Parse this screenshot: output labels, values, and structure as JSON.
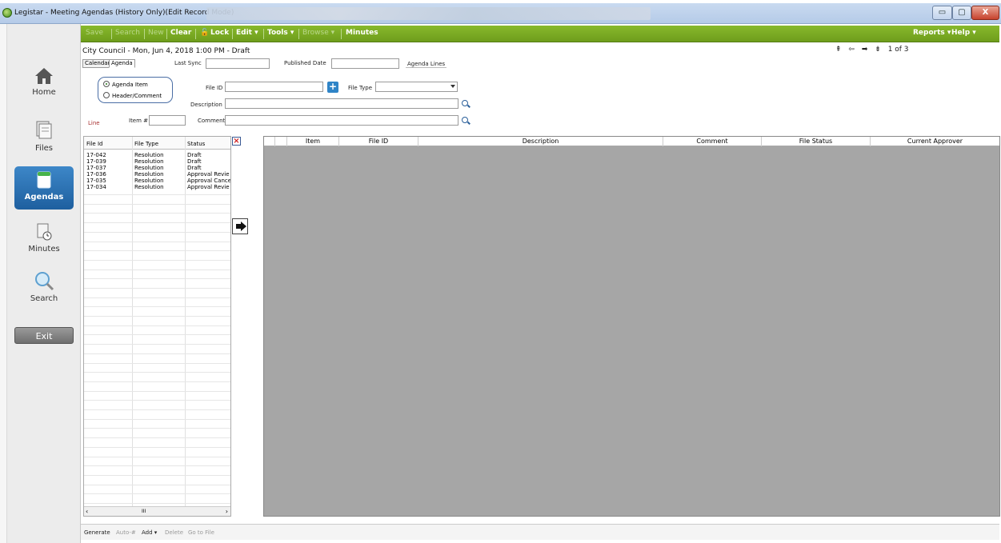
{
  "window": {
    "title": "Legistar - Meeting Agendas (History Only)(Edit Record Mode)",
    "min_glyph": "▭",
    "max_glyph": "▢",
    "close_glyph": "X"
  },
  "nav": {
    "items": [
      {
        "label": "Home",
        "icon": "home-icon"
      },
      {
        "label": "Files",
        "icon": "files-icon"
      },
      {
        "label": "Agendas",
        "icon": "agenda-icon"
      },
      {
        "label": "Minutes",
        "icon": "minutes-icon"
      },
      {
        "label": "Search",
        "icon": "search-icon"
      }
    ],
    "exit_label": "Exit"
  },
  "toolbar": {
    "save": "Save",
    "search": "Search",
    "new": "New",
    "clear": "Clear",
    "lock": "Lock",
    "edit": "Edit ▾",
    "tools": "Tools ▾",
    "browse": "Browse ▾",
    "minutes": "Minutes",
    "reports": "Reports ▾",
    "help": "Help ▾"
  },
  "header": {
    "title": "City Council - Mon, Jun 4, 2018 1:00 PM - Draft",
    "pager": {
      "first": "⇞",
      "prev": "⇦",
      "next": "➡",
      "last": "⇟",
      "text": "1 of 3"
    }
  },
  "tabs": {
    "calendar": "Calendar",
    "agenda": "Agenda"
  },
  "fields": {
    "last_sync_label": "Last Sync",
    "published_date_label": "Published Date",
    "agenda_lines_label": "Agenda Lines",
    "agenda_item_label": "Agenda Item",
    "header_comment_label": "Header/Comment",
    "file_id_label": "File ID",
    "file_type_label": "File Type",
    "description_label": "Description",
    "line_label": "Line",
    "item_label": "Item #",
    "comment_label": "Comment"
  },
  "list": {
    "columns": [
      "File Id",
      "File Type",
      "Status"
    ],
    "rows": [
      [
        "17-042",
        "Resolution",
        "Draft"
      ],
      [
        "17-039",
        "Resolution",
        "Draft"
      ],
      [
        "17-037",
        "Resolution",
        "Draft"
      ],
      [
        "17-036",
        "Resolution",
        "Approval Revie"
      ],
      [
        "17-035",
        "Resolution",
        "Approval Cance"
      ],
      [
        "17-034",
        "Resolution",
        "Approval Revie"
      ]
    ],
    "scroll_mid": "III"
  },
  "grid": {
    "columns": [
      "Item",
      "File ID",
      "Description",
      "Comment",
      "File Status",
      "Current Approver"
    ]
  },
  "bottom": {
    "generate": "Generate",
    "auto_num": "Auto-#",
    "add": "Add ▾",
    "delete": "Delete",
    "go_to_file": "Go to File"
  },
  "colors": {
    "toolbar_green": "#7aab22",
    "nav_active": "#2b72b5",
    "grid_bg": "#a6a6a6"
  }
}
